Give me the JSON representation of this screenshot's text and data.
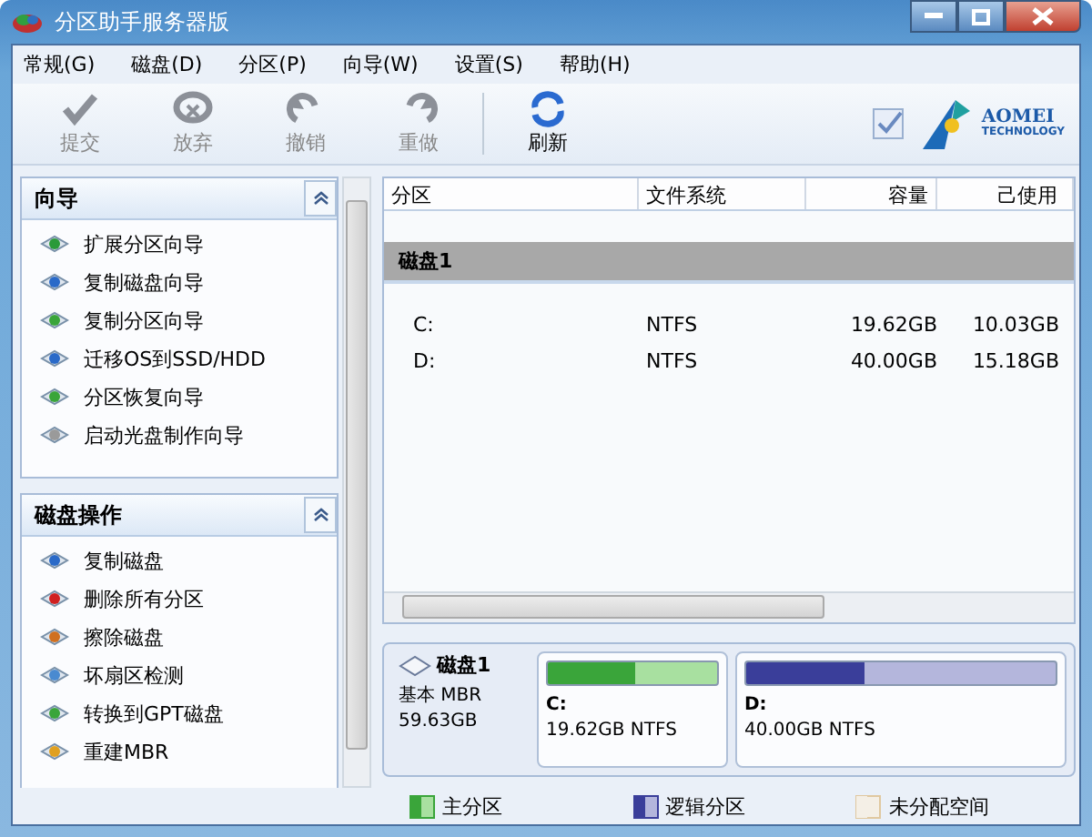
{
  "window": {
    "title": "分区助手服务器版"
  },
  "menu": [
    "常规(G)",
    "磁盘(D)",
    "分区(P)",
    "向导(W)",
    "设置(S)",
    "帮助(H)"
  ],
  "toolbar": [
    {
      "label": "提交",
      "kind": "check",
      "disabled": true
    },
    {
      "label": "放弃",
      "kind": "discard",
      "disabled": true
    },
    {
      "label": "撤销",
      "kind": "undo",
      "disabled": true
    },
    {
      "label": "重做",
      "kind": "redo",
      "disabled": true
    },
    {
      "label": "刷新",
      "kind": "refresh",
      "disabled": false
    }
  ],
  "brand": {
    "name": "AOMEI",
    "tagline": "TECHNOLOGY"
  },
  "sidebar": [
    {
      "title": "向导",
      "expanded": true,
      "items": [
        {
          "label": "扩展分区向导",
          "kind": "extend"
        },
        {
          "label": "复制磁盘向导",
          "kind": "copy"
        },
        {
          "label": "复制分区向导",
          "kind": "copypart"
        },
        {
          "label": "迁移OS到SSD/HDD",
          "kind": "copy"
        },
        {
          "label": "分区恢复向导",
          "kind": "recover"
        },
        {
          "label": "启动光盘制作向导",
          "kind": "cd"
        }
      ]
    },
    {
      "title": "磁盘操作",
      "expanded": true,
      "items": [
        {
          "label": "复制磁盘",
          "kind": "copy"
        },
        {
          "label": "删除所有分区",
          "kind": "delete"
        },
        {
          "label": "擦除磁盘",
          "kind": "wipe"
        },
        {
          "label": "坏扇区检测",
          "kind": "scan"
        },
        {
          "label": "转换到GPT磁盘",
          "kind": "recover"
        },
        {
          "label": "重建MBR",
          "kind": "mbr"
        }
      ]
    }
  ],
  "table": {
    "columns": [
      "分区",
      "文件系统",
      "容量",
      "己使用"
    ],
    "group": "磁盘1",
    "rows": [
      {
        "partition": "C:",
        "filesystem": "NTFS",
        "capacity": "19.62GB",
        "used": "10.03GB"
      },
      {
        "partition": "D:",
        "filesystem": "NTFS",
        "capacity": "40.00GB",
        "used": "15.18GB"
      }
    ]
  },
  "disk_map": {
    "name": "磁盘1",
    "type": "基本 MBR",
    "size": "59.63GB",
    "partitions": [
      {
        "letter": "C:",
        "info": "19.62GB NTFS",
        "kind": "primary",
        "level": 0.52
      },
      {
        "letter": "D:",
        "info": "40.00GB NTFS",
        "kind": "logical",
        "level": 0.38
      }
    ]
  },
  "legend": [
    {
      "label": "主分区",
      "kind": "primary"
    },
    {
      "label": "逻辑分区",
      "kind": "logical"
    },
    {
      "label": "未分配空间",
      "kind": "unallocated"
    }
  ]
}
